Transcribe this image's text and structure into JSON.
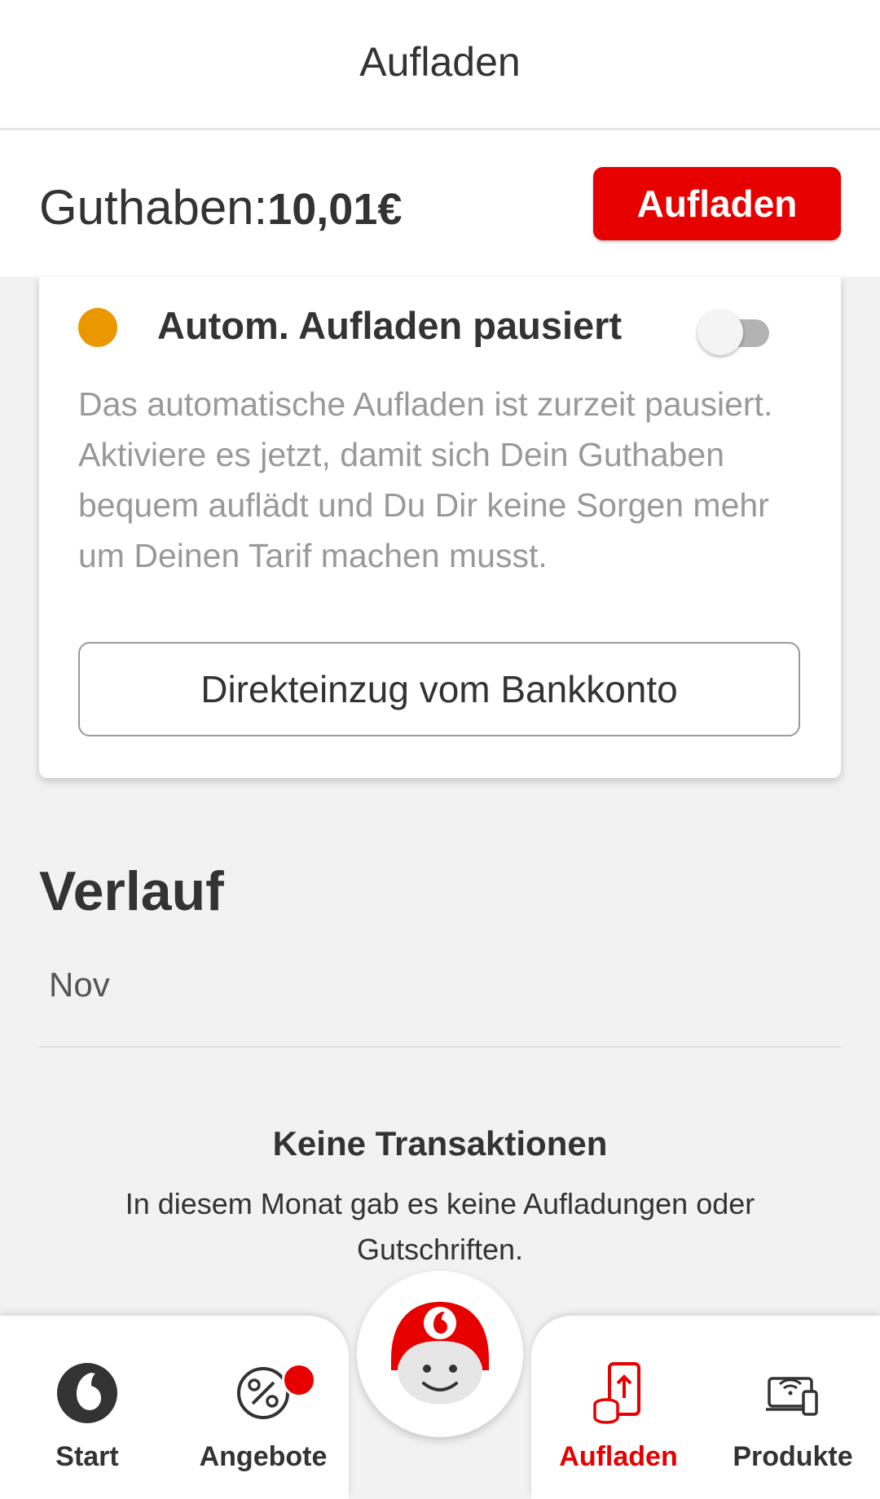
{
  "header": {
    "title": "Aufladen"
  },
  "balance": {
    "label": "Guthaben:",
    "amount": "10,01€",
    "topup_label": "Aufladen"
  },
  "auto_topup": {
    "status_color": "#eb9700",
    "title": "Autom. Aufladen pausiert",
    "toggle_on": false,
    "description": "Das automatische Aufladen ist zurzeit pausiert. Aktiviere es jetzt, damit sich Dein Guthaben bequem auflädt und Du Dir keine Sorgen mehr um Deinen Tarif machen musst.",
    "debit_button_label": "Direkteinzug vom Bankkonto"
  },
  "history": {
    "title": "Verlauf",
    "month": "Nov",
    "empty_title": "Keine Transaktionen",
    "empty_text": "In diesem Monat gab es keine Aufladungen oder Gutschriften."
  },
  "nav": {
    "items": [
      {
        "label": "Start",
        "icon": "vodafone-logo-icon"
      },
      {
        "label": "Angebote",
        "icon": "percent-icon"
      },
      {
        "label": "Aufladen",
        "icon": "topup-icon",
        "active": true
      },
      {
        "label": "Produkte",
        "icon": "devices-icon"
      }
    ],
    "center_icon": "mascot-icon"
  },
  "colors": {
    "brand_red": "#e60000",
    "status_orange": "#eb9700"
  }
}
